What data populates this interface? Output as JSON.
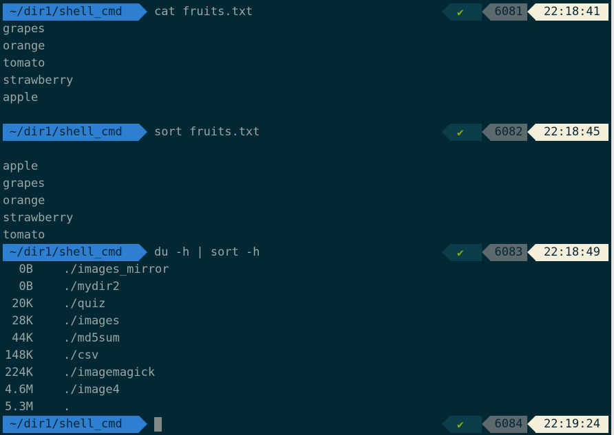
{
  "colors": {
    "background": "#022933",
    "text": "#9aa6a6",
    "path_segment": "#2f7fd0",
    "status_check_bg": "#0c3d4a",
    "check_mark": "#8eaa13",
    "history_bg": "#5c6a6e",
    "time_bg": "#f4efdb"
  },
  "prompts": [
    {
      "path": "~/dir1/shell_cmd",
      "command": "cat fruits.txt",
      "status_icon": "check-icon",
      "status": "✔",
      "history_number": "6081",
      "time": "22:18:41"
    },
    {
      "path": "~/dir1/shell_cmd",
      "command": "sort fruits.txt",
      "status_icon": "check-icon",
      "status": "✔",
      "history_number": "6082",
      "time": "22:18:45"
    },
    {
      "path": "~/dir1/shell_cmd",
      "command": "du -h | sort -h",
      "status_icon": "check-icon",
      "status": "✔",
      "history_number": "6083",
      "time": "22:18:49"
    },
    {
      "path": "~/dir1/shell_cmd",
      "command": "",
      "status_icon": "check-icon",
      "status": "✔",
      "history_number": "6084",
      "time": "22:19:24"
    }
  ],
  "cat_output": [
    "grapes",
    "orange",
    "tomato",
    "strawberry",
    "apple"
  ],
  "sort_output": [
    "apple",
    "grapes",
    "orange",
    "strawberry",
    "tomato"
  ],
  "du_output": [
    {
      "size": "0B",
      "path": "./images_mirror"
    },
    {
      "size": "0B",
      "path": "./mydir2"
    },
    {
      "size": "20K",
      "path": "./quiz"
    },
    {
      "size": "28K",
      "path": "./images"
    },
    {
      "size": "44K",
      "path": "./md5sum"
    },
    {
      "size": "148K",
      "path": "./csv"
    },
    {
      "size": "224K",
      "path": "./imagemagick"
    },
    {
      "size": "4.6M",
      "path": "./image4"
    },
    {
      "size": "5.3M",
      "path": "."
    }
  ]
}
